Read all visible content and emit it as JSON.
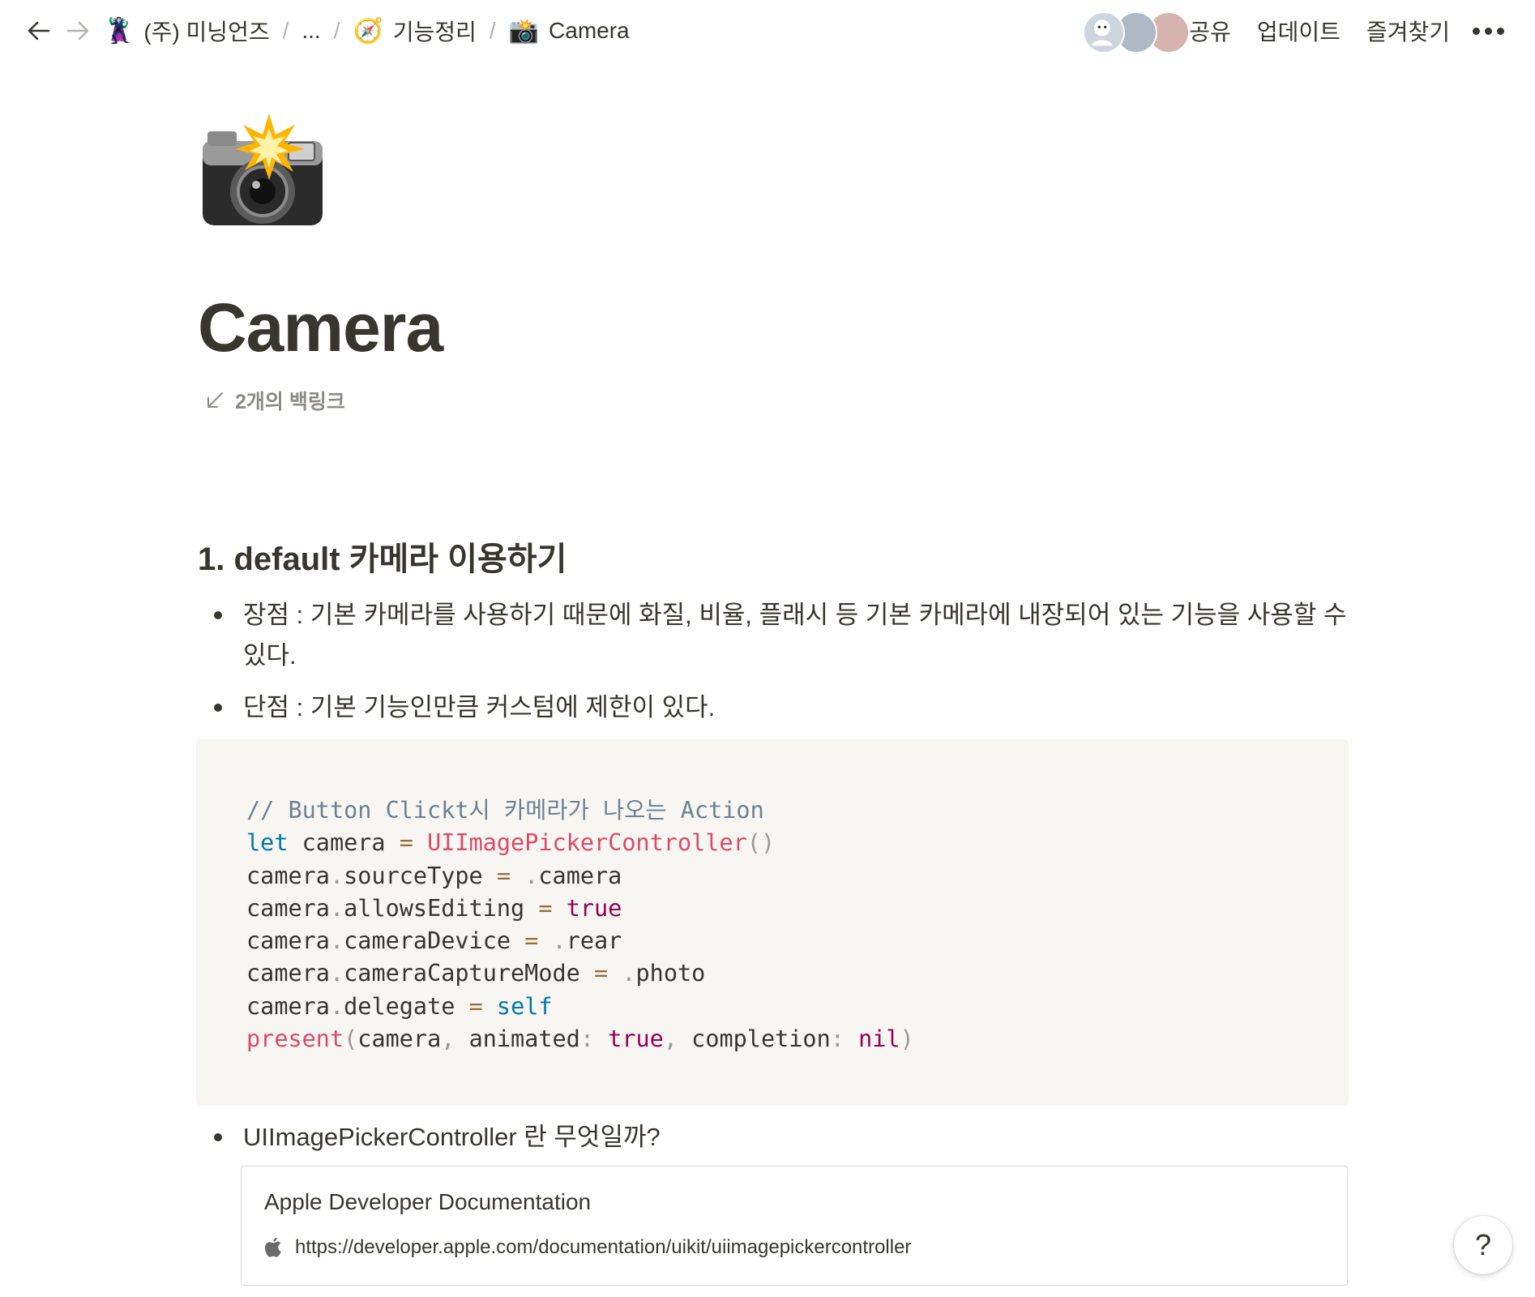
{
  "breadcrumb": {
    "items": [
      {
        "icon": "minion-emoji",
        "emoji": "🦹",
        "label": "(주) 미닝언즈"
      },
      {
        "label": "..."
      },
      {
        "icon": "compass-emoji",
        "emoji": "🧭",
        "label": "기능정리"
      },
      {
        "icon": "camera-flash-emoji",
        "emoji": "📸",
        "label": "Camera"
      }
    ],
    "separator": "/"
  },
  "topbar": {
    "share_label": "공유",
    "updates_label": "업데이트",
    "favorite_label": "즐겨찾기",
    "avatar_colors": [
      "#cfd5de",
      "#aeb8c6",
      "#d8b4ae"
    ]
  },
  "page": {
    "icon": "camera-flash-emoji",
    "title": "Camera",
    "backlinks_label": "2개의 백링크"
  },
  "content": {
    "heading1": "1. default 카메라 이용하기",
    "bullet_pro": "장점 : 기본 카메라를 사용하기 때문에 화질, 비율, 플래시 등 기본 카메라에 내장되어 있는 기능을 사용할 수 있다.",
    "bullet_con": "단점 : 기본 기능인만큼 커스텀에 제한이 있다.",
    "code": {
      "language": "swift",
      "lines": [
        "// Button Clickt시 카메라가 나오는 Action",
        "let camera = UIImagePickerController()",
        "camera.sourceType = .camera",
        "camera.allowsEditing = true",
        "camera.cameraDevice = .rear",
        "camera.cameraCaptureMode = .photo",
        "camera.delegate = self",
        "present(camera, animated: true, completion: nil)"
      ]
    },
    "bullet_question": "UIImagePickerController 란 무엇일까?",
    "bookmark": {
      "title": "Apple Developer Documentation",
      "url": "https://developer.apple.com/documentation/uikit/uiimagepickercontroller",
      "icon": "apple-logo-icon"
    }
  },
  "help_label": "?"
}
